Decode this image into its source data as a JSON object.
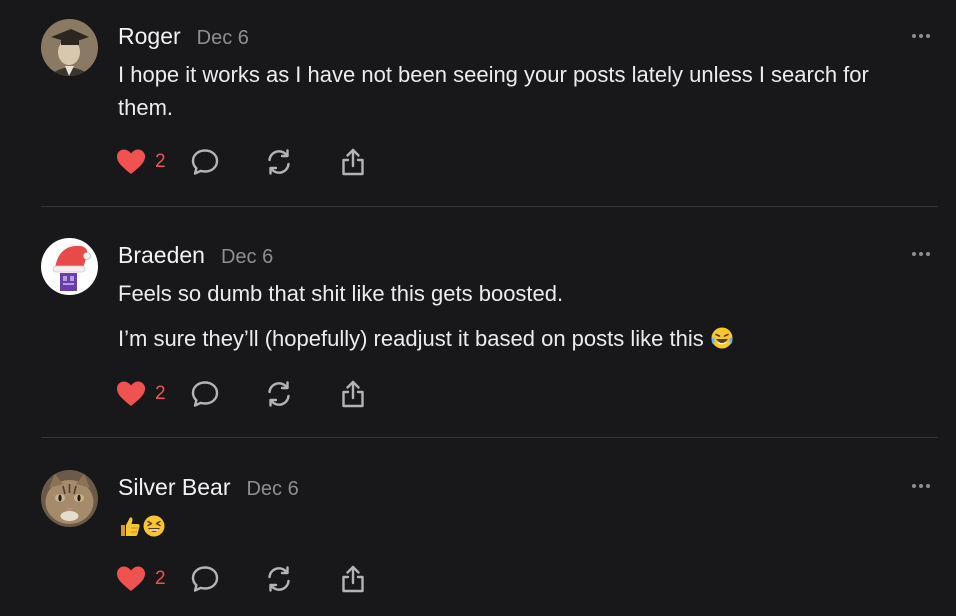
{
  "colors": {
    "background": "#18181a",
    "like_red": "#f0524f",
    "muted": "#8e8e93",
    "divider": "#343438"
  },
  "posts": [
    {
      "author": "Roger",
      "date": "Dec 6",
      "paragraphs": [
        "I hope it works as I have not been seeing your posts lately unless I search for them."
      ],
      "likes": "2",
      "avatar_icon": "vintage-graduation-photo-avatar"
    },
    {
      "author": "Braeden",
      "date": "Dec 6",
      "paragraphs": [
        "Feels so dumb that shit like this gets boosted.",
        "I’m sure they’ll (hopefully) readjust it based on posts like this"
      ],
      "likes": "2",
      "avatar_icon": "santa-hat-avatar",
      "trailing_emoji": "tears-of-joy-emoji"
    },
    {
      "author": "Silver Bear",
      "date": "Dec 6",
      "paragraphs": [],
      "emojis": [
        "thumbs-up-emoji",
        "grinning-squint-emoji"
      ],
      "likes": "2",
      "avatar_icon": "cat-face-avatar"
    }
  ]
}
